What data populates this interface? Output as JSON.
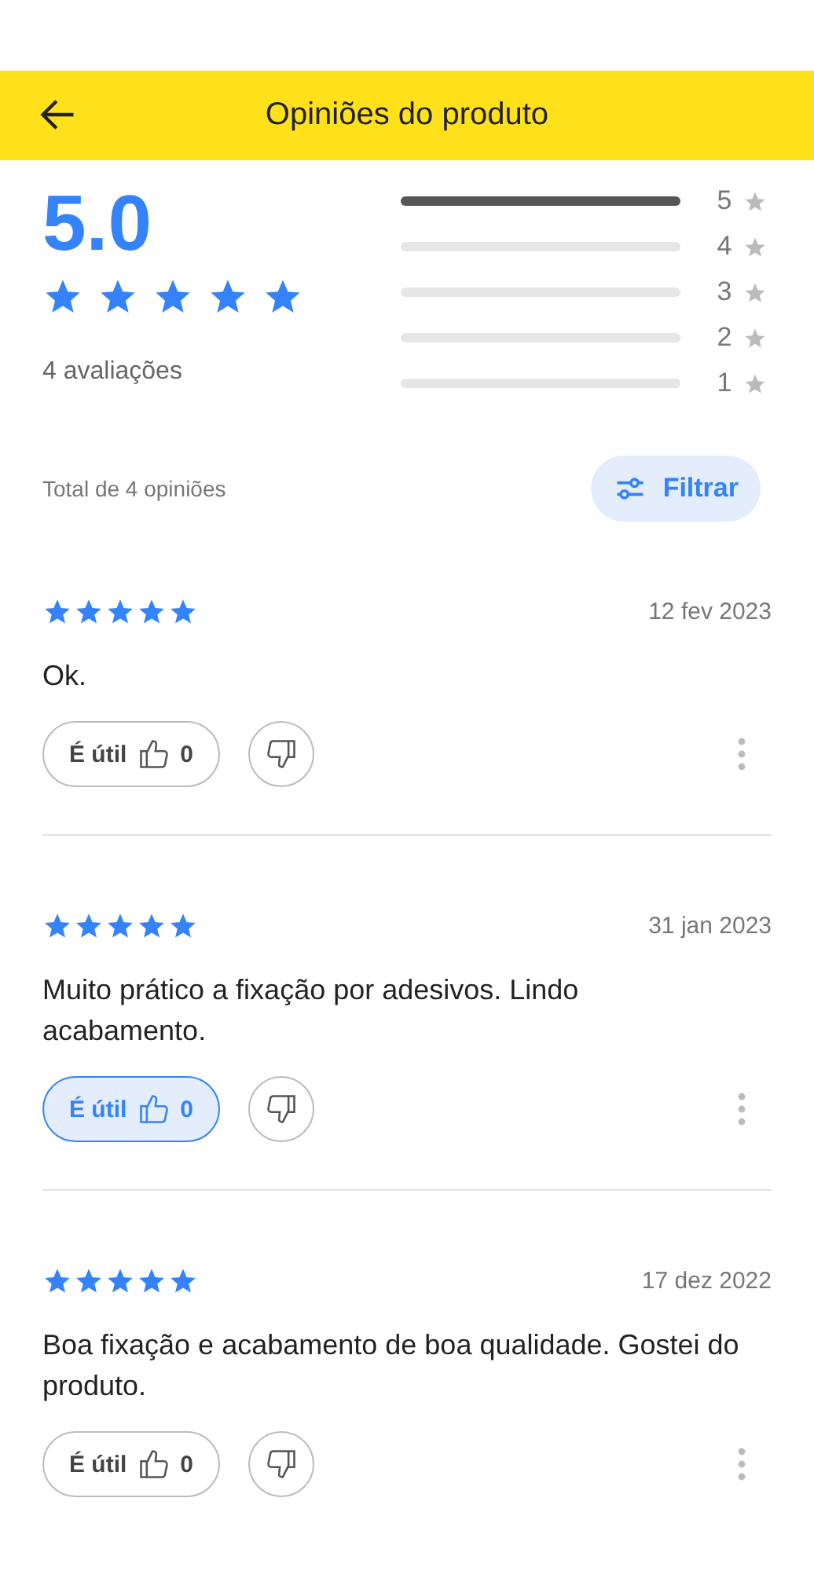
{
  "header": {
    "title": "Opiniões do produto"
  },
  "summary": {
    "score": "5.0",
    "stars": 5,
    "count_label": "4 avaliações"
  },
  "distribution": [
    {
      "label": "5",
      "level": 1
    },
    {
      "label": "4",
      "level": 0
    },
    {
      "label": "3",
      "level": 0
    },
    {
      "label": "2",
      "level": 0
    },
    {
      "label": "1",
      "level": 0
    }
  ],
  "total_label": "Total de 4 opiniões",
  "filter_button": "Filtrar",
  "reviews": [
    {
      "stars": 5,
      "date": "12 fev 2023",
      "text": "Ok.",
      "helpful_label": "É útil",
      "helpful_count": "0",
      "selected": false
    },
    {
      "stars": 5,
      "date": "31 jan 2023",
      "text": "Muito prático a fixação por adesivos. Lindo acabamento.",
      "helpful_label": "É útil",
      "helpful_count": "0",
      "selected": true
    },
    {
      "stars": 5,
      "date": "17 dez 2022",
      "text": "Boa fixação e acabamento de boa qualidade. Gostei do produto.",
      "helpful_label": "É útil",
      "helpful_count": "0",
      "selected": false
    }
  ]
}
